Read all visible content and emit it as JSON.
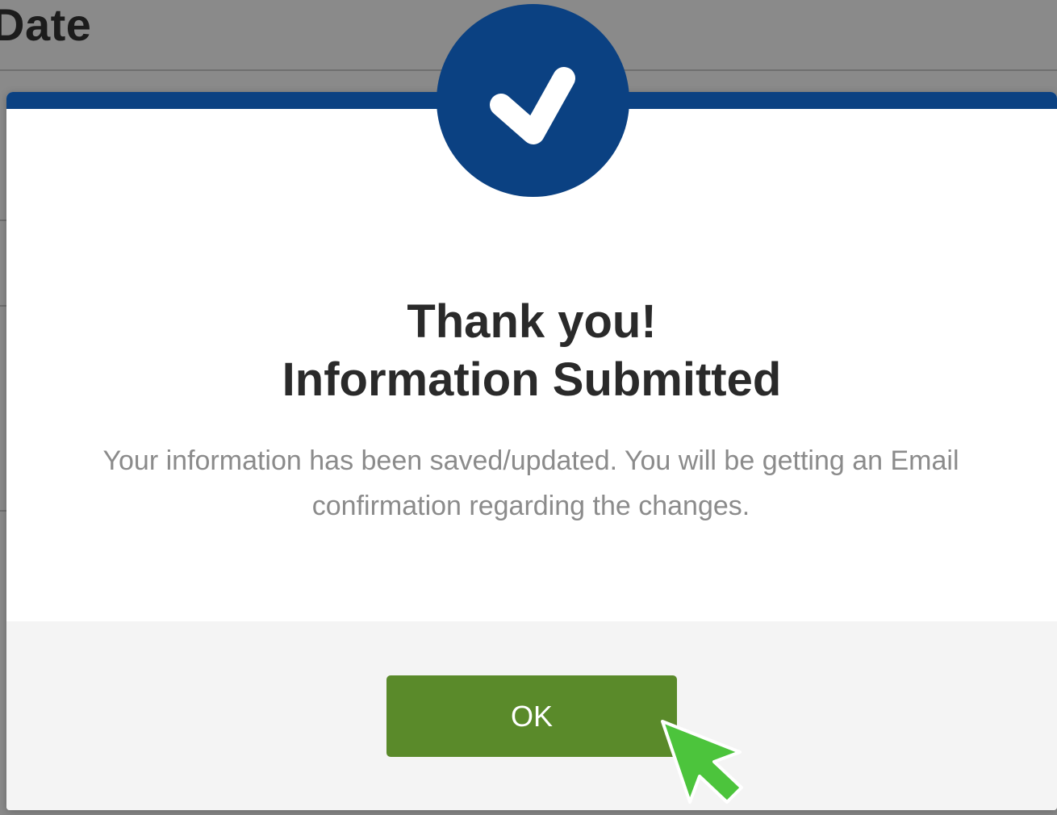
{
  "background": {
    "page_title": "Date"
  },
  "modal": {
    "title_line1": "Thank you!",
    "title_line2": "Information Submitted",
    "message": "Your information has been saved/updated. You will be getting an Email confirmation regarding the changes.",
    "ok_label": "OK"
  },
  "icons": {
    "badge": "checkmark-icon",
    "cursor": "mouse-pointer-icon"
  },
  "colors": {
    "brand_blue": "#0b4182",
    "ok_green": "#5a8a2a",
    "cursor_green": "#4cc43c"
  }
}
